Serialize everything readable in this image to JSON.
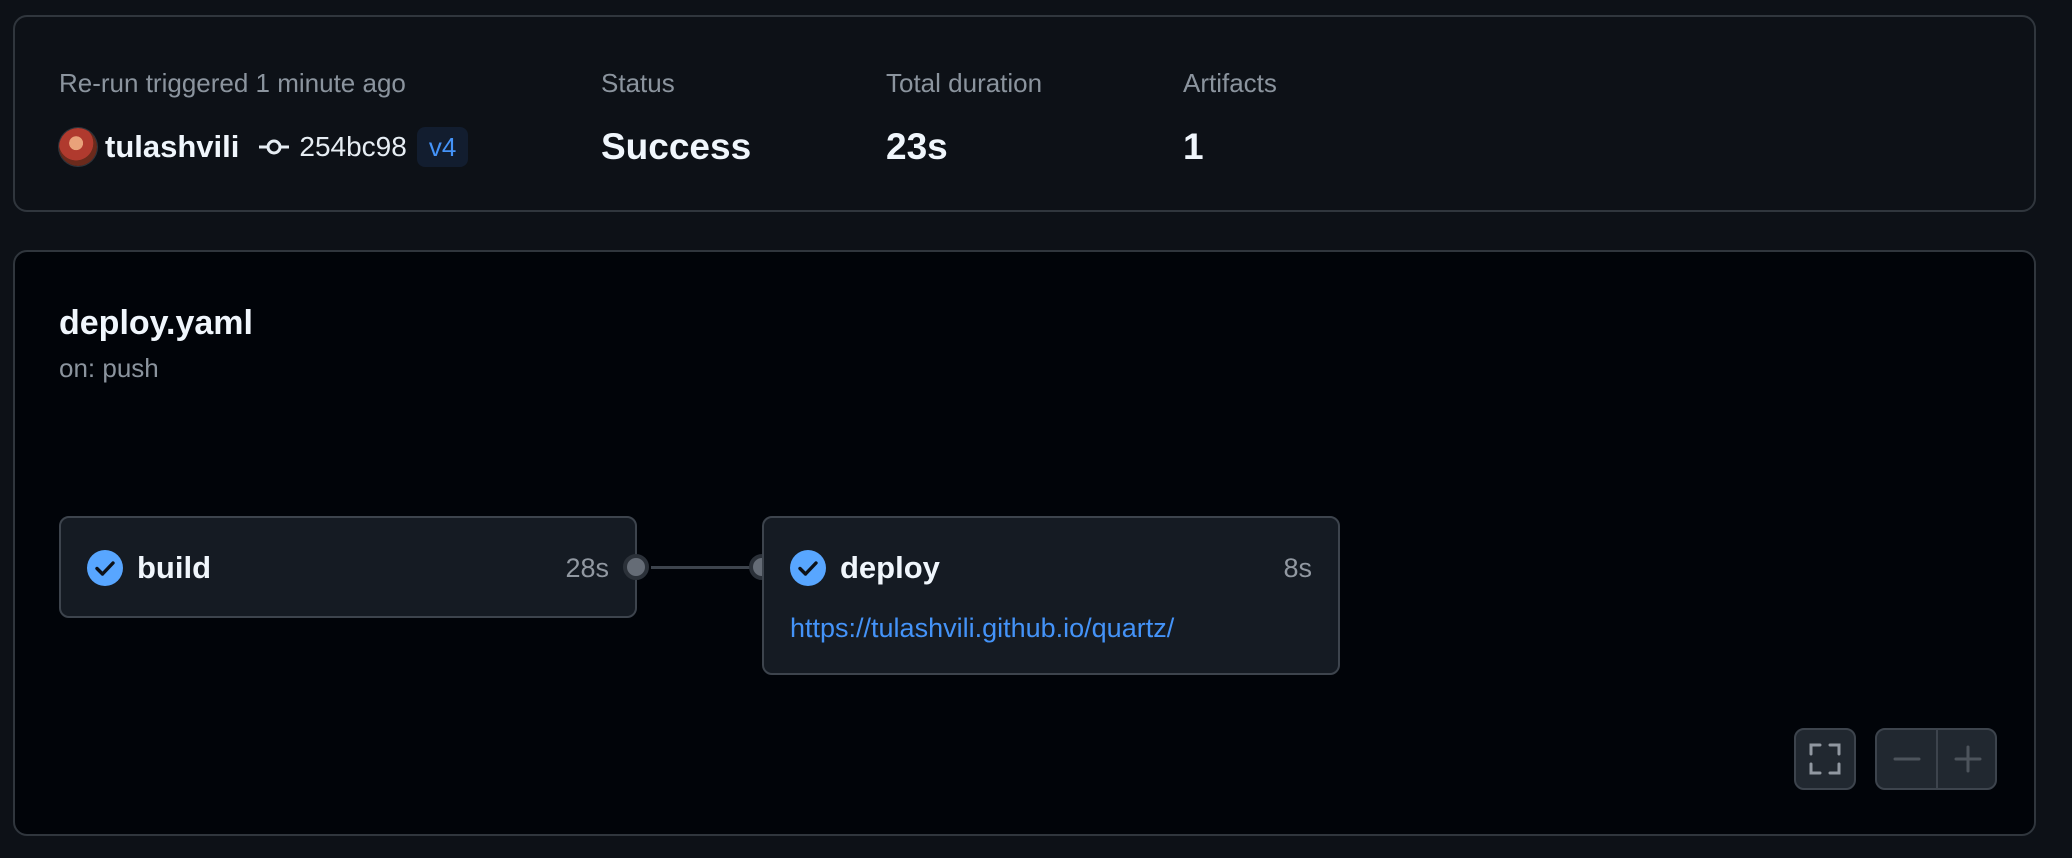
{
  "summary": {
    "trigger_label": "Re-run triggered 1 minute ago",
    "username": "tulashvili",
    "commit_sha": "254bc98",
    "tag": "v4",
    "status_label": "Status",
    "status_value": "Success",
    "duration_label": "Total duration",
    "duration_value": "23s",
    "artifacts_label": "Artifacts",
    "artifacts_value": "1"
  },
  "workflow": {
    "file": "deploy.yaml",
    "trigger": "on: push",
    "jobs": [
      {
        "name": "build",
        "duration": "28s",
        "status": "success"
      },
      {
        "name": "deploy",
        "duration": "8s",
        "status": "success",
        "url": "https://tulashvili.github.io/quartz/"
      }
    ]
  },
  "controls": {
    "fullscreen_icon": "fullscreen-icon",
    "zoom_out_icon": "minus-icon",
    "zoom_in_icon": "plus-icon"
  },
  "colors": {
    "accent": "#4493f8",
    "success_icon": "#58a6ff",
    "background": "#0d1117",
    "canvas": "#010409",
    "border": "#30363d"
  }
}
